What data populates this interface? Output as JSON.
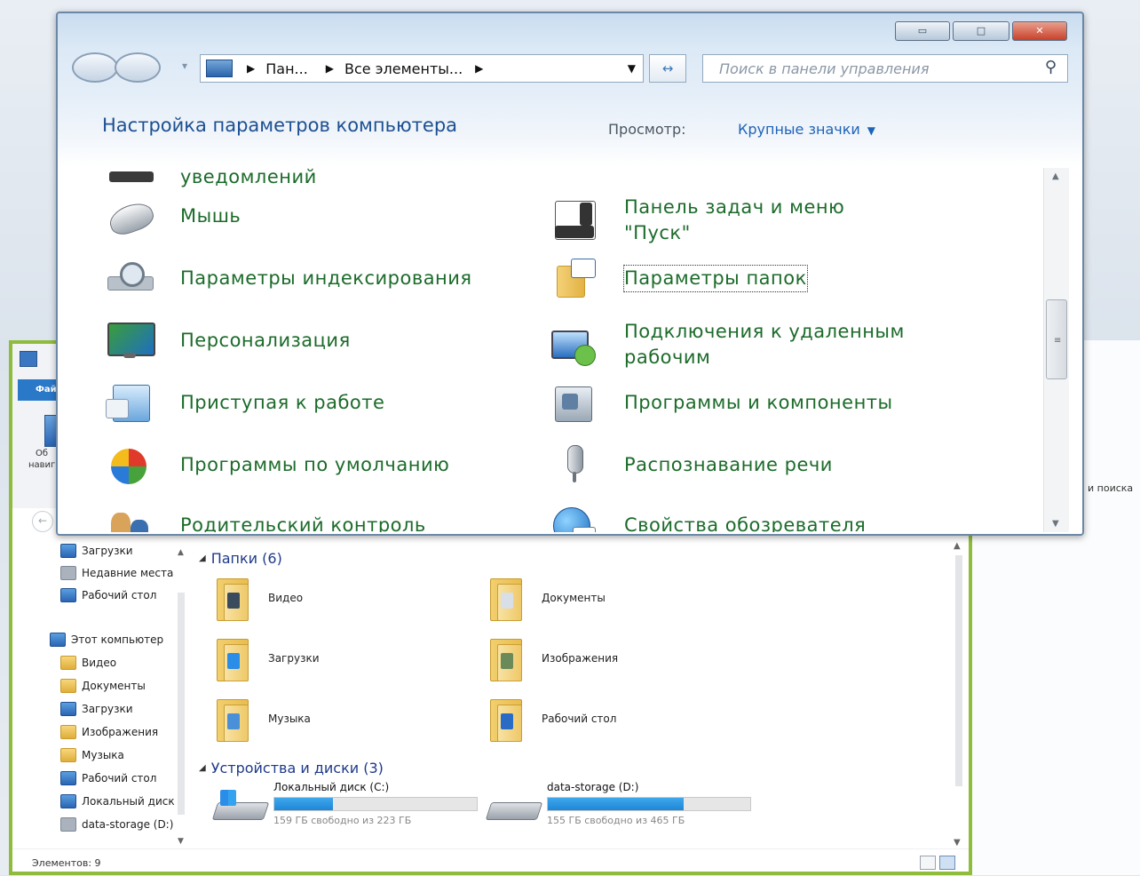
{
  "control_panel": {
    "address": {
      "crumb1": "Пан...",
      "crumb2": "Все элементы..."
    },
    "search_placeholder": "Поиск в панели управления",
    "title": "Настройка параметров компьютера",
    "view_label": "Просмотр:",
    "view_value": "Крупные значки",
    "items_left": [
      {
        "label": "уведомлений",
        "icon": "notification-icon"
      },
      {
        "label": "Мышь",
        "icon": "mouse-icon"
      },
      {
        "label": "Параметры индексирования",
        "icon": "indexing-icon"
      },
      {
        "label": "Персонализация",
        "icon": "personalization-icon"
      },
      {
        "label": "Приступая к работе",
        "icon": "getting-started-icon"
      },
      {
        "label": "Программы по умолчанию",
        "icon": "default-programs-icon"
      },
      {
        "label": "Родительский контроль",
        "icon": "parental-control-icon"
      }
    ],
    "items_right": [
      {
        "label": "Панель задач и меню \"Пуск\"",
        "icon": "taskbar-icon"
      },
      {
        "label": "Параметры папок",
        "icon": "folder-options-icon"
      },
      {
        "label": "Подключения к удаленным рабочим",
        "icon": "remote-desktop-icon"
      },
      {
        "label": "Программы и компоненты",
        "icon": "programs-features-icon"
      },
      {
        "label": "Распознавание речи",
        "icon": "microphone-icon"
      },
      {
        "label": "Свойства обозревателя",
        "icon": "internet-options-icon"
      }
    ]
  },
  "explorer": {
    "tab_short": "Фай",
    "ribbon_label_short": "Об",
    "ribbon_label_short2": "навиг",
    "nav": [
      {
        "label": "Загрузки",
        "icon": "downloads-icon"
      },
      {
        "label": "Недавние места",
        "icon": "recent-places-icon"
      },
      {
        "label": "Рабочий стол",
        "icon": "desktop-icon"
      },
      {
        "label": "Этот компьютер",
        "icon": "computer-icon"
      },
      {
        "label": "Видео",
        "icon": "videos-icon"
      },
      {
        "label": "Документы",
        "icon": "documents-icon"
      },
      {
        "label": "Загрузки",
        "icon": "downloads-icon"
      },
      {
        "label": "Изображения",
        "icon": "pictures-icon"
      },
      {
        "label": "Музыка",
        "icon": "music-icon"
      },
      {
        "label": "Рабочий стол",
        "icon": "desktop-icon"
      },
      {
        "label": "Локальный диск",
        "icon": "local-disk-icon"
      },
      {
        "label": "data-storage (D:)",
        "icon": "drive-icon"
      }
    ],
    "folders_group": "Папки (6)",
    "folders": [
      "Видео",
      "Документы",
      "Загрузки",
      "Изображения",
      "Музыка",
      "Рабочий стол"
    ],
    "devices_group": "Устройства и диски (3)",
    "drives": [
      {
        "name": "Локальный диск (C:)",
        "free": "159 ГБ свободно из 223 ГБ",
        "used_fraction": 0.29
      },
      {
        "name": "data-storage (D:)",
        "free": "155 ГБ свободно из 465 ГБ",
        "used_fraction": 0.67
      }
    ],
    "status": "Элементов: 9",
    "search_fragment": "и поиска"
  },
  "colors": {
    "link_green": "#1c6b2a",
    "title_blue": "#1d4f91",
    "explorer_border": "#8fbd3b",
    "drive_bar": "#1f86d8"
  }
}
